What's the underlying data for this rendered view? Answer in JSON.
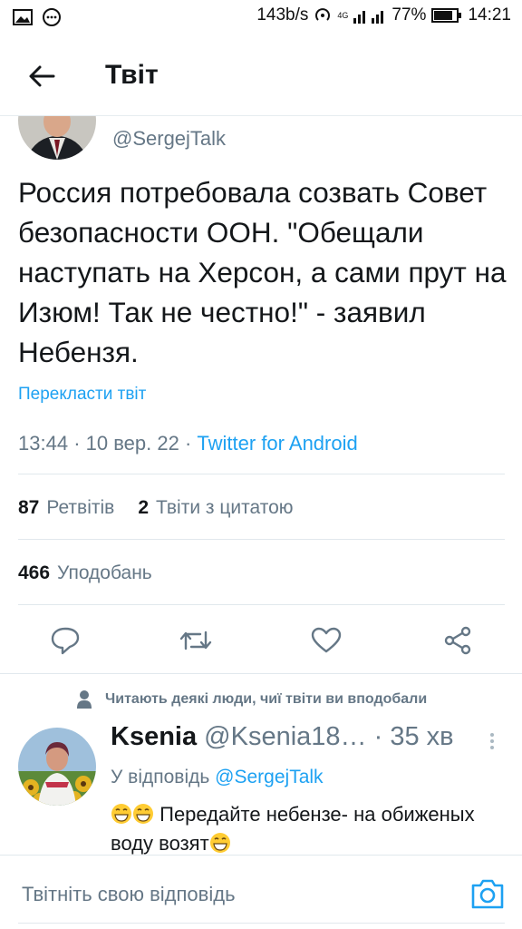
{
  "status_bar": {
    "net_speed": "143b/s",
    "network": "4G",
    "battery": "77%",
    "time": "14:21"
  },
  "header": {
    "title": "Твіт"
  },
  "tweet": {
    "handle": "@SergejTalk",
    "text": "Россия потребовала созвать Совет безопасности ООН. \"Обещали наступать на Херсон, а сами прут на Изюм! Так не честно!\" - заявил Небензя.",
    "translate_label": "Перекласти твіт",
    "time": "13:44",
    "date": "10 вер. 22",
    "source": "Twitter for Android",
    "retweets_count": "87",
    "retweets_label": "Ретвітів",
    "quotes_count": "2",
    "quotes_label": "Твіти з цитатою",
    "likes_count": "466",
    "likes_label": "Уподобань"
  },
  "actions": {
    "icons": [
      "reply-icon",
      "retweet-icon",
      "like-icon",
      "share-icon"
    ]
  },
  "reply": {
    "social_context": "Читають деякі люди, чиї твіти ви вподобали",
    "name": "Ksenia",
    "handle": "@Ksenia18…",
    "time": "35 хв",
    "in_reply_prefix": "У відповідь",
    "in_reply_handle": "@SergejTalk",
    "text_part1": "Передайте небензе- на обиженых воду возят"
  },
  "compose": {
    "placeholder": "Твітніть свою відповідь"
  },
  "colors": {
    "accent": "#1da1f2",
    "secondary_text": "#657786",
    "primary_text": "#14171a"
  }
}
